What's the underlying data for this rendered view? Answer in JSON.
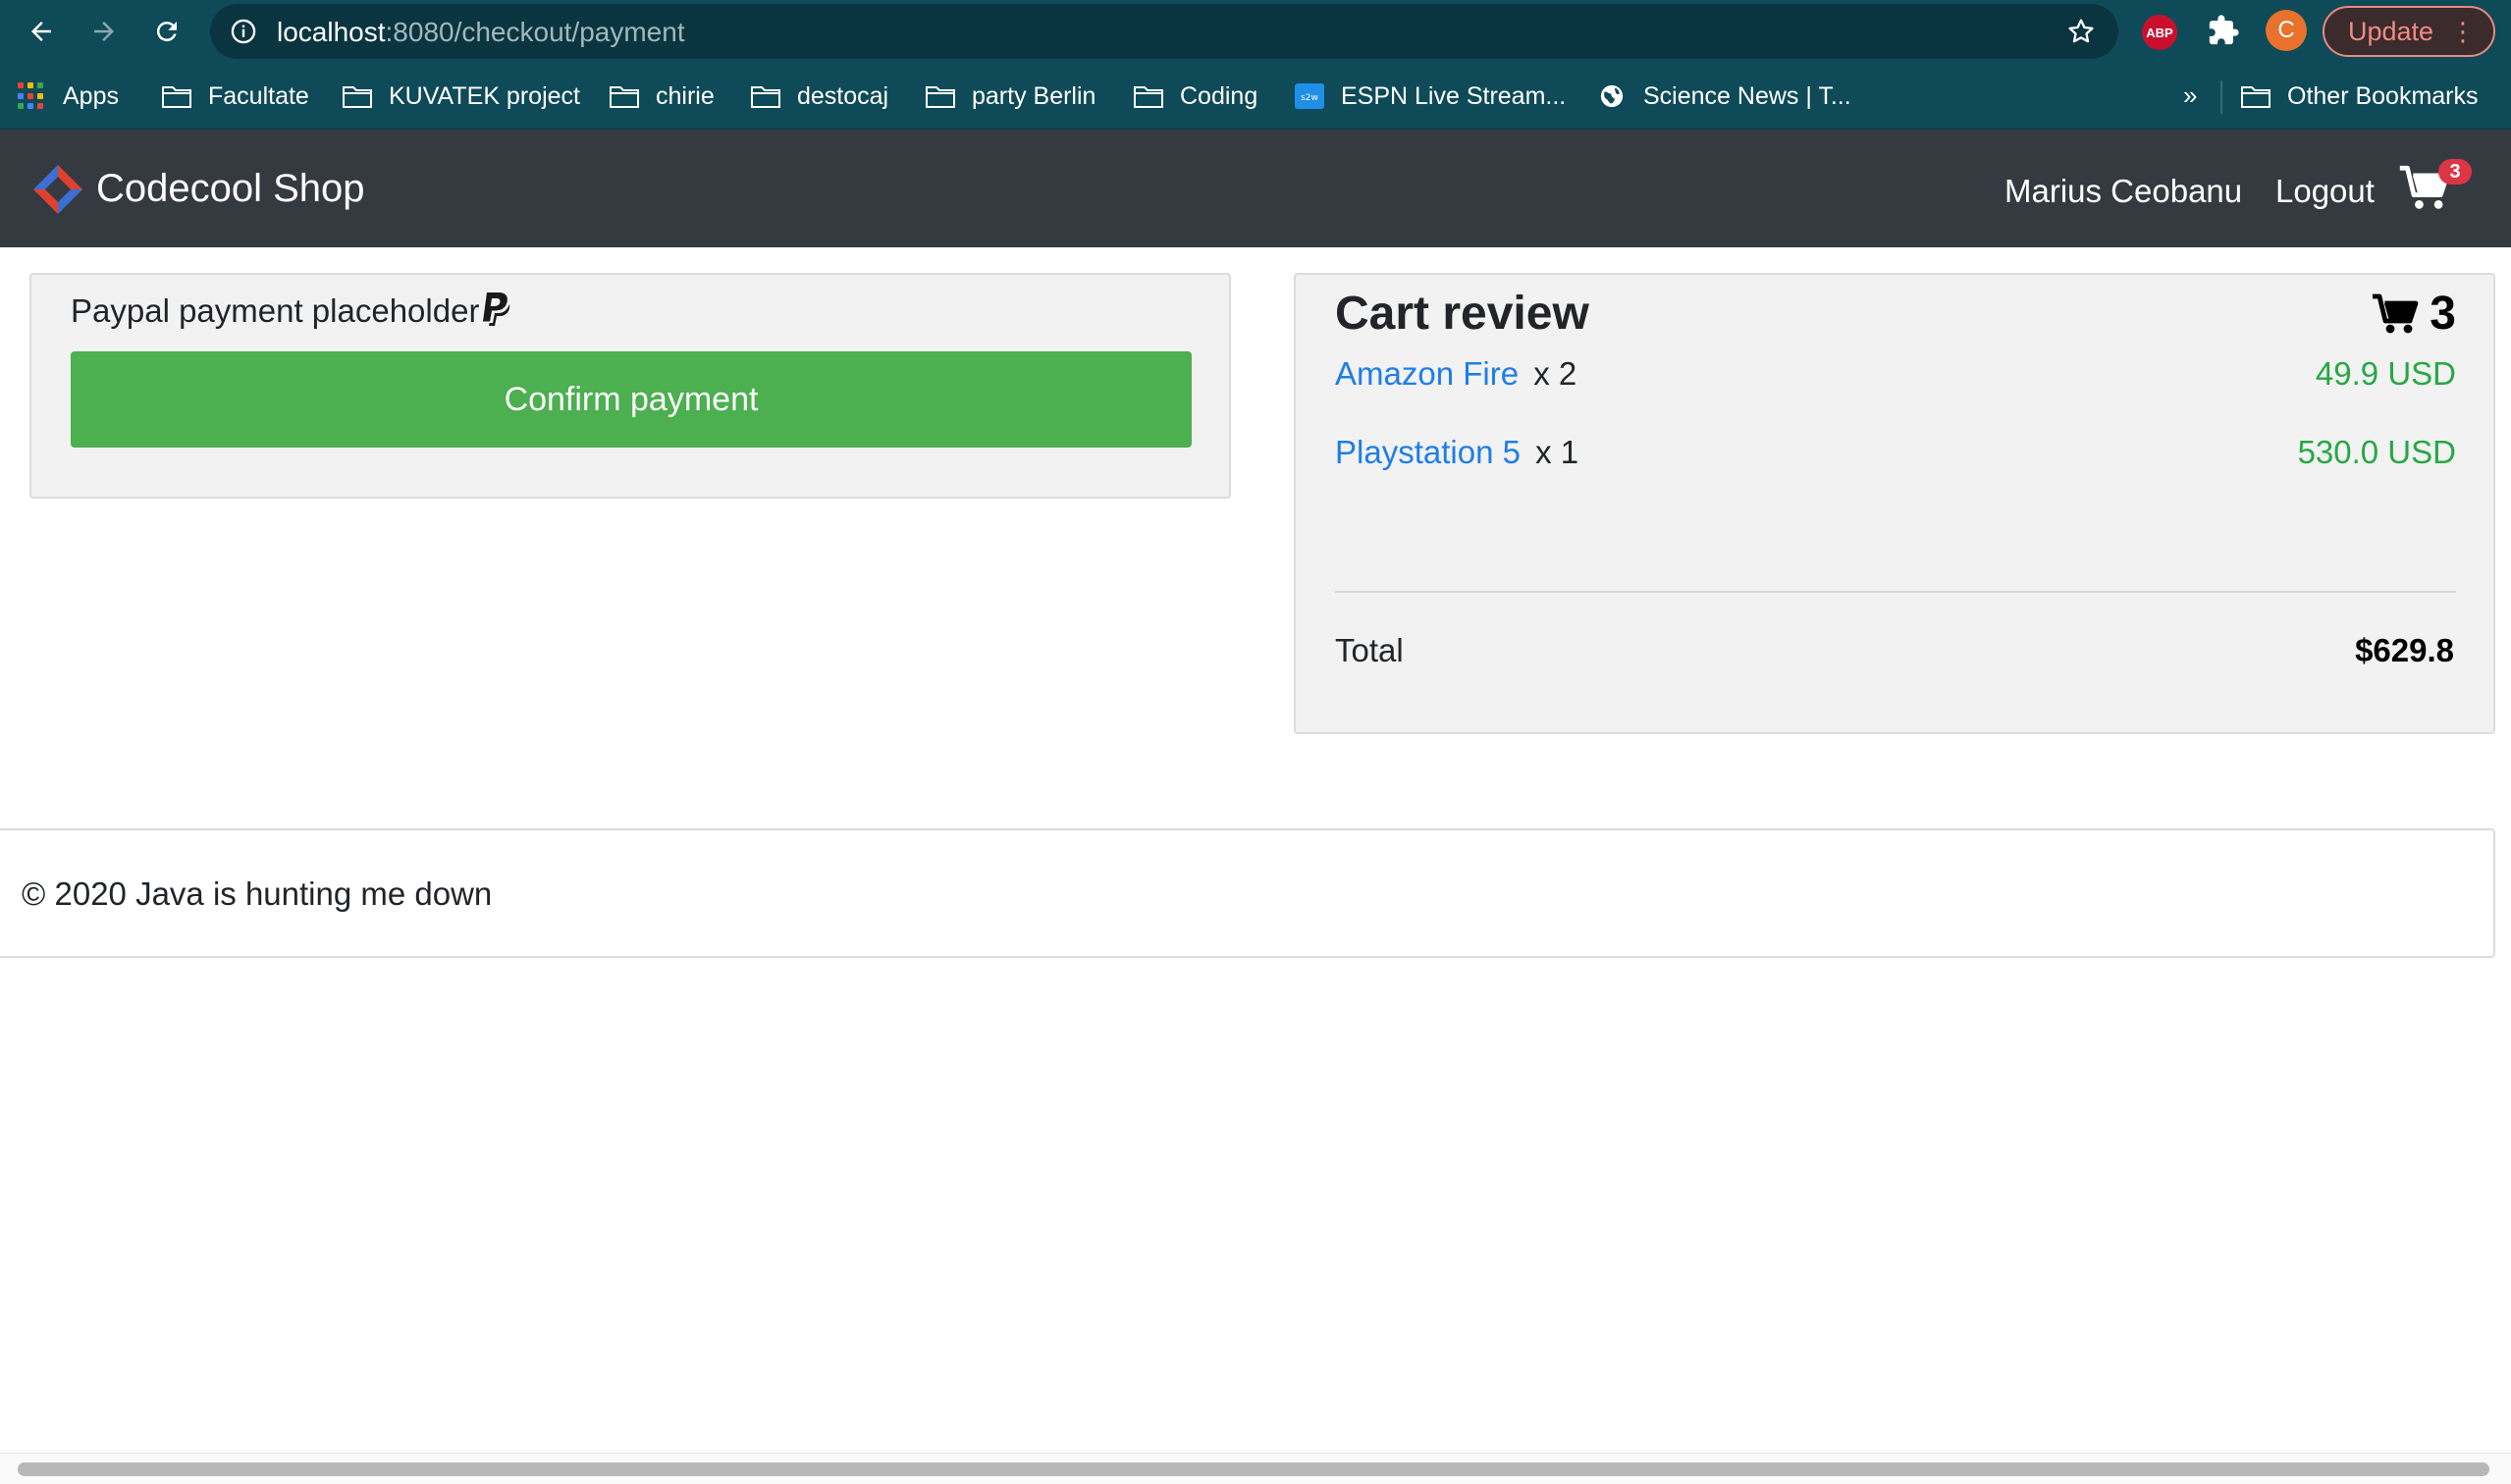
{
  "browser": {
    "url_host": "localhost",
    "url_path": ":8080/checkout/payment",
    "profile_initial": "C",
    "update_label": "Update",
    "menu_dots": "⋮",
    "abp_label": "ABP"
  },
  "bookmarks": {
    "apps": "Apps",
    "items": [
      "Facultate",
      "KUVATEK project",
      "chirie",
      "destocaj",
      "party Berlin",
      "Coding",
      "ESPN Live Stream...",
      "Science News | T..."
    ],
    "more": "»",
    "other": "Other Bookmarks"
  },
  "navbar": {
    "brand": "Codecool Shop",
    "user": "Marius Ceobanu",
    "logout": "Logout",
    "cart_badge": "3"
  },
  "payment": {
    "title": "Paypal payment placeholder",
    "confirm_label": "Confirm payment"
  },
  "cart_review": {
    "title": "Cart review",
    "count": "3",
    "items": [
      {
        "name": "Amazon Fire",
        "qty": "x 2",
        "price": "49.9 USD"
      },
      {
        "name": "Playstation 5",
        "qty": "x 1",
        "price": "530.0 USD"
      }
    ],
    "total_label": "Total",
    "total_value": "$629.8"
  },
  "footer": {
    "text": "© 2020 Java is hunting me down"
  },
  "colors": {
    "browser_chrome": "#0e4a57",
    "navbar": "#343a40",
    "confirm_button": "#4caf50",
    "link_blue": "#1e7ee8",
    "price_green": "#28a745",
    "badge_red": "#dc3545"
  }
}
